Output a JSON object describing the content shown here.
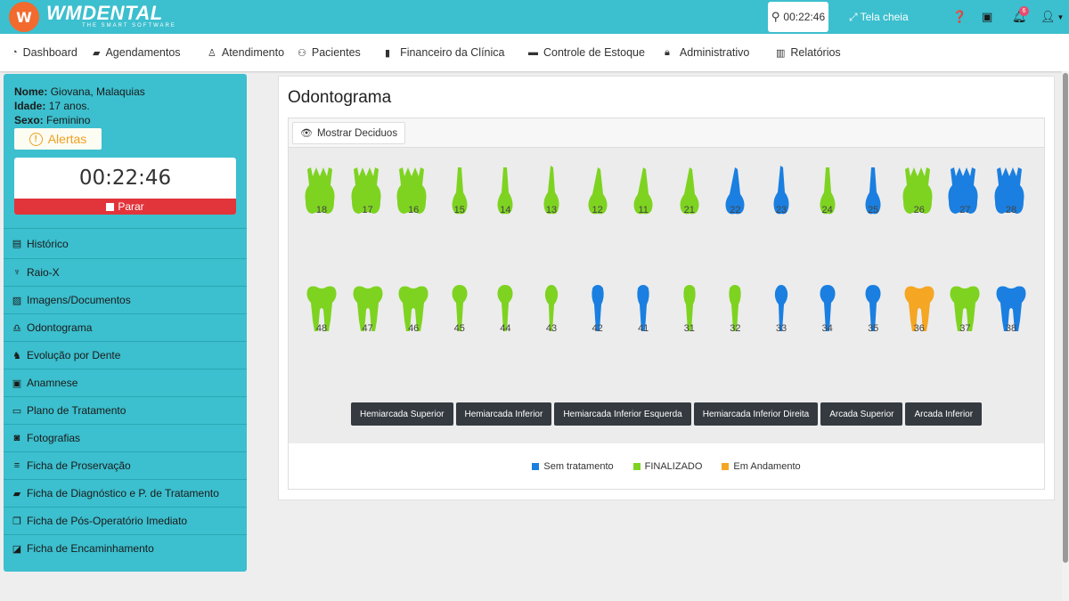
{
  "header": {
    "logo_mark": "W",
    "brand_name": "WMDENTAL",
    "brand_tagline": "THE SMART SOFTWARE",
    "timer": "00:22:46",
    "fullscreen_label": "Tela cheia",
    "notification_count": "6",
    "accent_color": "#3cbfce"
  },
  "nav": {
    "items": [
      {
        "label": "Dashboard",
        "icon": "tachometer-icon"
      },
      {
        "label": "Agendamentos",
        "icon": "book-icon"
      },
      {
        "label": "Atendimento",
        "icon": "user-md-icon"
      },
      {
        "label": "Pacientes",
        "icon": "users-icon"
      },
      {
        "label": "Financeiro da Clínica",
        "icon": "bookmark-icon"
      },
      {
        "label": "Controle de Estoque",
        "icon": "archive-icon"
      },
      {
        "label": "Administrativo",
        "icon": "lock-icon"
      },
      {
        "label": "Relatórios",
        "icon": "bar-chart-icon"
      }
    ]
  },
  "patient": {
    "name_label": "Nome:",
    "name": "Giovana, Malaquias",
    "age_label": "Idade:",
    "age": "17 anos.",
    "sex_label": "Sexo:",
    "sex": "Feminino",
    "alerts_label": "Alertas",
    "session_timer": "00:22:46",
    "stop_label": "Parar"
  },
  "sidebar": {
    "items": [
      {
        "label": "Histórico",
        "icon": "list-icon"
      },
      {
        "label": "Raio-X",
        "icon": "tooth-xray-icon"
      },
      {
        "label": "Imagens/Documentos",
        "icon": "image-icon"
      },
      {
        "label": "Odontograma",
        "icon": "tooth-icon"
      },
      {
        "label": "Evolução por Dente",
        "icon": "evolution-icon"
      },
      {
        "label": "Anamnese",
        "icon": "id-card-icon"
      },
      {
        "label": "Plano de Tratamento",
        "icon": "money-icon"
      },
      {
        "label": "Fotografias",
        "icon": "camera-icon"
      },
      {
        "label": "Ficha de Proservação",
        "icon": "bars-icon"
      },
      {
        "label": "Ficha de Diagnóstico e P. de Tratamento",
        "icon": "book-icon"
      },
      {
        "label": "Ficha de Pós-Operatório Imediato",
        "icon": "copy-icon"
      },
      {
        "label": "Ficha de Encaminhamento",
        "icon": "share-icon"
      }
    ]
  },
  "odontograma": {
    "title": "Odontograma",
    "show_deciduous_label": "Mostrar Deciduos",
    "status_colors": {
      "sem_tratamento": "#1a7fe0",
      "finalizado": "#7ed321",
      "em_andamento": "#f5a623"
    },
    "upper_teeth": [
      {
        "number": "18",
        "status": "finalizado",
        "shape": "molar"
      },
      {
        "number": "17",
        "status": "finalizado",
        "shape": "molar"
      },
      {
        "number": "16",
        "status": "finalizado",
        "shape": "molar"
      },
      {
        "number": "15",
        "status": "finalizado",
        "shape": "premolar"
      },
      {
        "number": "14",
        "status": "finalizado",
        "shape": "premolar"
      },
      {
        "number": "13",
        "status": "finalizado",
        "shape": "canine"
      },
      {
        "number": "12",
        "status": "finalizado",
        "shape": "incisor"
      },
      {
        "number": "11",
        "status": "finalizado",
        "shape": "incisor"
      },
      {
        "number": "21",
        "status": "finalizado",
        "shape": "incisor"
      },
      {
        "number": "22",
        "status": "sem_tratamento",
        "shape": "incisor"
      },
      {
        "number": "23",
        "status": "sem_tratamento",
        "shape": "canine"
      },
      {
        "number": "24",
        "status": "finalizado",
        "shape": "premolar"
      },
      {
        "number": "25",
        "status": "sem_tratamento",
        "shape": "premolar"
      },
      {
        "number": "26",
        "status": "finalizado",
        "shape": "molar"
      },
      {
        "number": "27",
        "status": "sem_tratamento",
        "shape": "molar"
      },
      {
        "number": "28",
        "status": "sem_tratamento",
        "shape": "molar"
      }
    ],
    "lower_teeth": [
      {
        "number": "48",
        "status": "finalizado",
        "shape": "molar"
      },
      {
        "number": "47",
        "status": "finalizado",
        "shape": "molar"
      },
      {
        "number": "46",
        "status": "finalizado",
        "shape": "molar"
      },
      {
        "number": "45",
        "status": "finalizado",
        "shape": "premolar"
      },
      {
        "number": "44",
        "status": "finalizado",
        "shape": "premolar"
      },
      {
        "number": "43",
        "status": "finalizado",
        "shape": "canine"
      },
      {
        "number": "42",
        "status": "sem_tratamento",
        "shape": "incisor"
      },
      {
        "number": "41",
        "status": "sem_tratamento",
        "shape": "incisor"
      },
      {
        "number": "31",
        "status": "finalizado",
        "shape": "incisor"
      },
      {
        "number": "32",
        "status": "finalizado",
        "shape": "incisor"
      },
      {
        "number": "33",
        "status": "sem_tratamento",
        "shape": "canine"
      },
      {
        "number": "34",
        "status": "sem_tratamento",
        "shape": "premolar"
      },
      {
        "number": "35",
        "status": "sem_tratamento",
        "shape": "premolar"
      },
      {
        "number": "36",
        "status": "em_andamento",
        "shape": "molar"
      },
      {
        "number": "37",
        "status": "finalizado",
        "shape": "molar"
      },
      {
        "number": "38",
        "status": "sem_tratamento",
        "shape": "molar"
      }
    ],
    "arch_buttons": [
      "Hemiarcada Superior",
      "Hemiarcada Inferior",
      "Hemiarcada Inferior Esquerda",
      "Hemiarcada Inferior Direita",
      "Arcada Superior",
      "Arcada Inferior"
    ],
    "legend": [
      {
        "label": "Sem tratamento",
        "status": "sem_tratamento"
      },
      {
        "label": "FINALIZADO",
        "status": "finalizado"
      },
      {
        "label": "Em Andamento",
        "status": "em_andamento"
      }
    ]
  }
}
